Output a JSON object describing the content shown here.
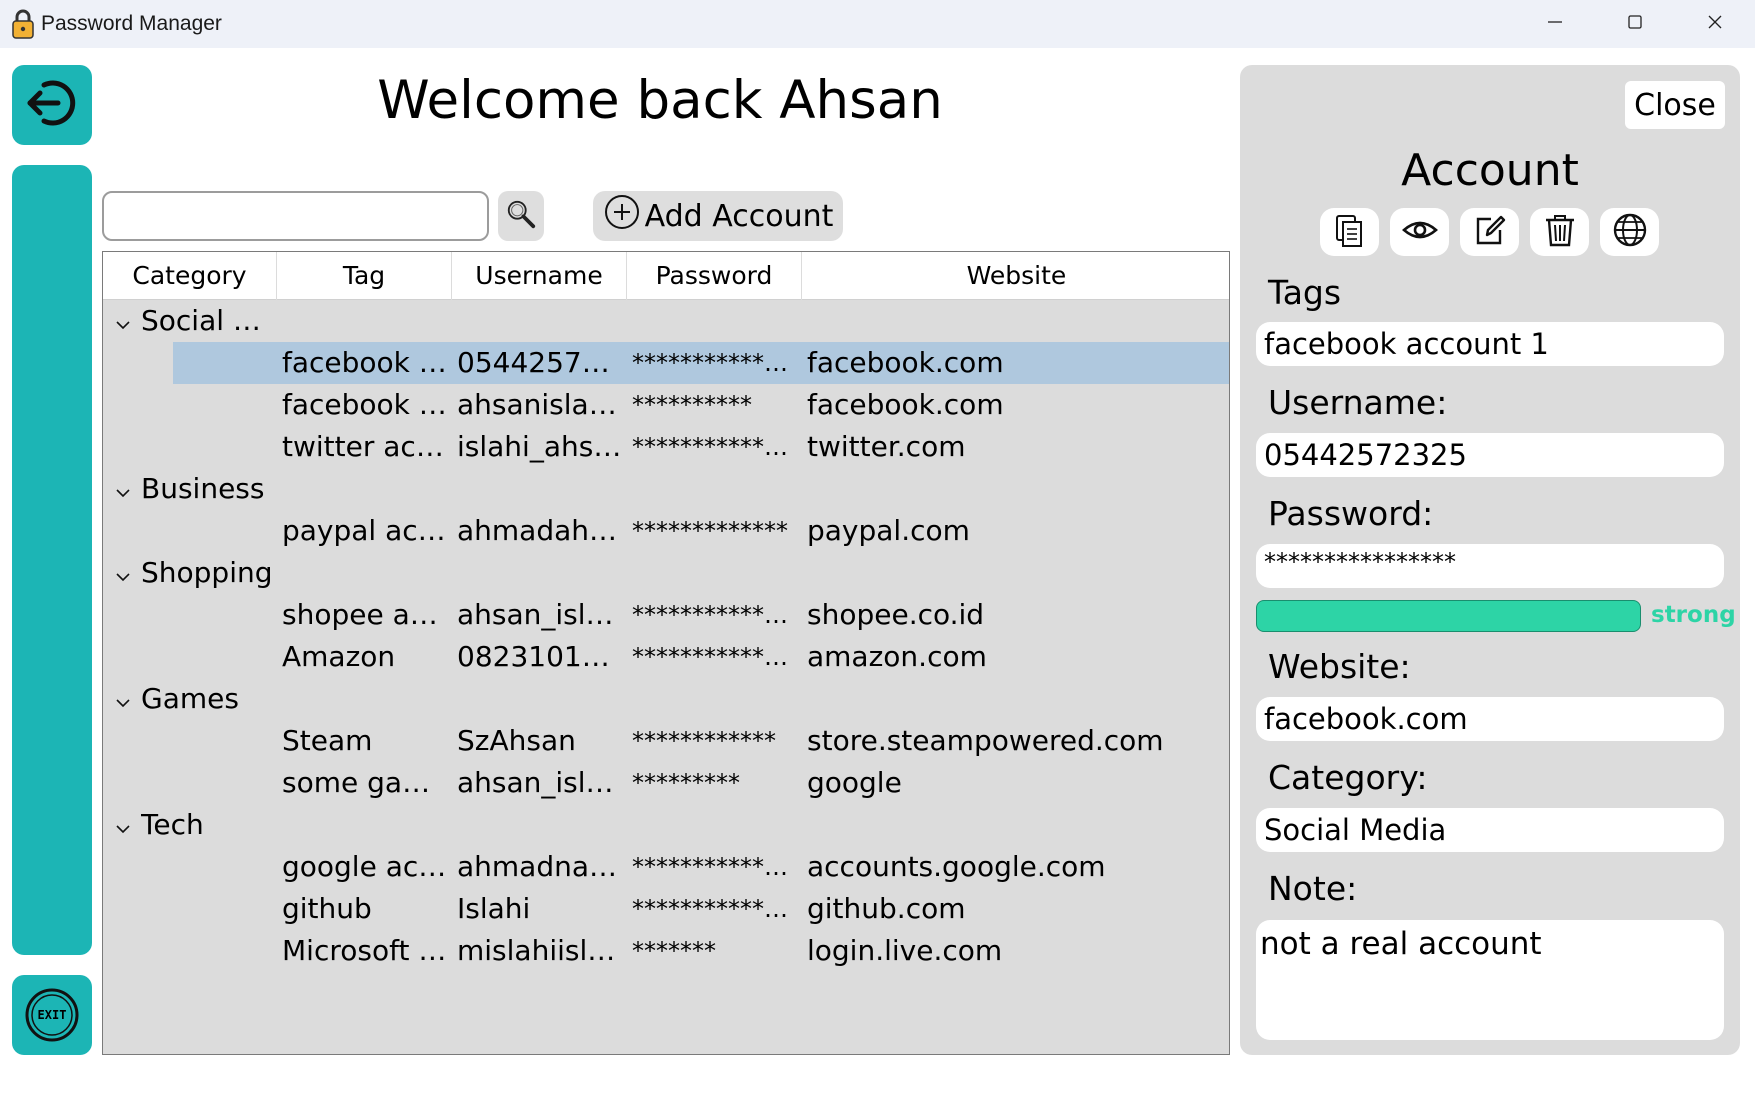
{
  "window": {
    "title": "Password Manager",
    "icon": "padlock-icon",
    "controls": [
      "minimize-icon",
      "maximize-icon",
      "close-icon"
    ]
  },
  "sidebar": {
    "back_icon": "logout-arrow-icon",
    "exit_label": "EXIT",
    "accent_color": "#1cb5b5"
  },
  "header": {
    "welcome": "Welcome back Ahsan"
  },
  "toolbar": {
    "search_value": "",
    "search_icon": "magnifier-icon",
    "add_label": "Add Account",
    "add_icon": "plus-circle-icon"
  },
  "table": {
    "columns": [
      "Category",
      "Tag",
      "Username",
      "Password",
      "Website"
    ],
    "groups": [
      {
        "category": "Social M...",
        "rows": [
          {
            "tag": "facebook a...",
            "username": "054425723...",
            "password": "************...",
            "website": "facebook.com",
            "selected": true
          },
          {
            "tag": "facebook a...",
            "username": "ahsanislahi...",
            "password": "**********",
            "website": "facebook.com"
          },
          {
            "tag": "twitter acc...",
            "username": "islahi_ahsan",
            "password": "************...",
            "website": "twitter.com"
          }
        ]
      },
      {
        "category": "Business",
        "rows": [
          {
            "tag": "paypal acc...",
            "username": "ahmadahsa...",
            "password": "*************",
            "website": "paypal.com"
          }
        ]
      },
      {
        "category": "Shopping",
        "rows": [
          {
            "tag": "shopee acc...",
            "username": "ahsan_islahi",
            "password": "************...",
            "website": "shopee.co.id"
          },
          {
            "tag": "Amazon",
            "username": "0823101056...",
            "password": "************...",
            "website": "amazon.com"
          }
        ]
      },
      {
        "category": "Games",
        "rows": [
          {
            "tag": "Steam",
            "username": "SzAhsan",
            "password": "************",
            "website": "store.steampowered.com"
          },
          {
            "tag": "some game...",
            "username": "ahsan_islahi",
            "password": "*********",
            "website": "google"
          }
        ]
      },
      {
        "category": "Tech",
        "rows": [
          {
            "tag": "google acc...",
            "username": "ahmadnam...",
            "password": "************...",
            "website": "accounts.google.com"
          },
          {
            "tag": "github",
            "username": "Islahi",
            "password": "************...",
            "website": "github.com"
          },
          {
            "tag": "Microsoft 3...",
            "username": "mislahiisla...",
            "password": "*******",
            "website": "login.live.com"
          }
        ]
      }
    ],
    "selected_color": "#afc8de"
  },
  "detail": {
    "close_label": "Close",
    "title": "Account",
    "actions": [
      "copy-icon",
      "eye-icon",
      "edit-icon",
      "trash-icon",
      "globe-icon"
    ],
    "tags_label": "Tags",
    "tags_value": "facebook account 1",
    "username_label": "Username:",
    "username_value": "05442572325",
    "password_label": "Password:",
    "password_value": "****************",
    "strength_label": "strong",
    "strength_level": 1.0,
    "strength_color": "#2dd4a6",
    "website_label": "Website:",
    "website_value": "facebook.com",
    "category_label": "Category:",
    "category_value": "Social Media",
    "note_label": "Note:",
    "note_value": "not a real account"
  }
}
